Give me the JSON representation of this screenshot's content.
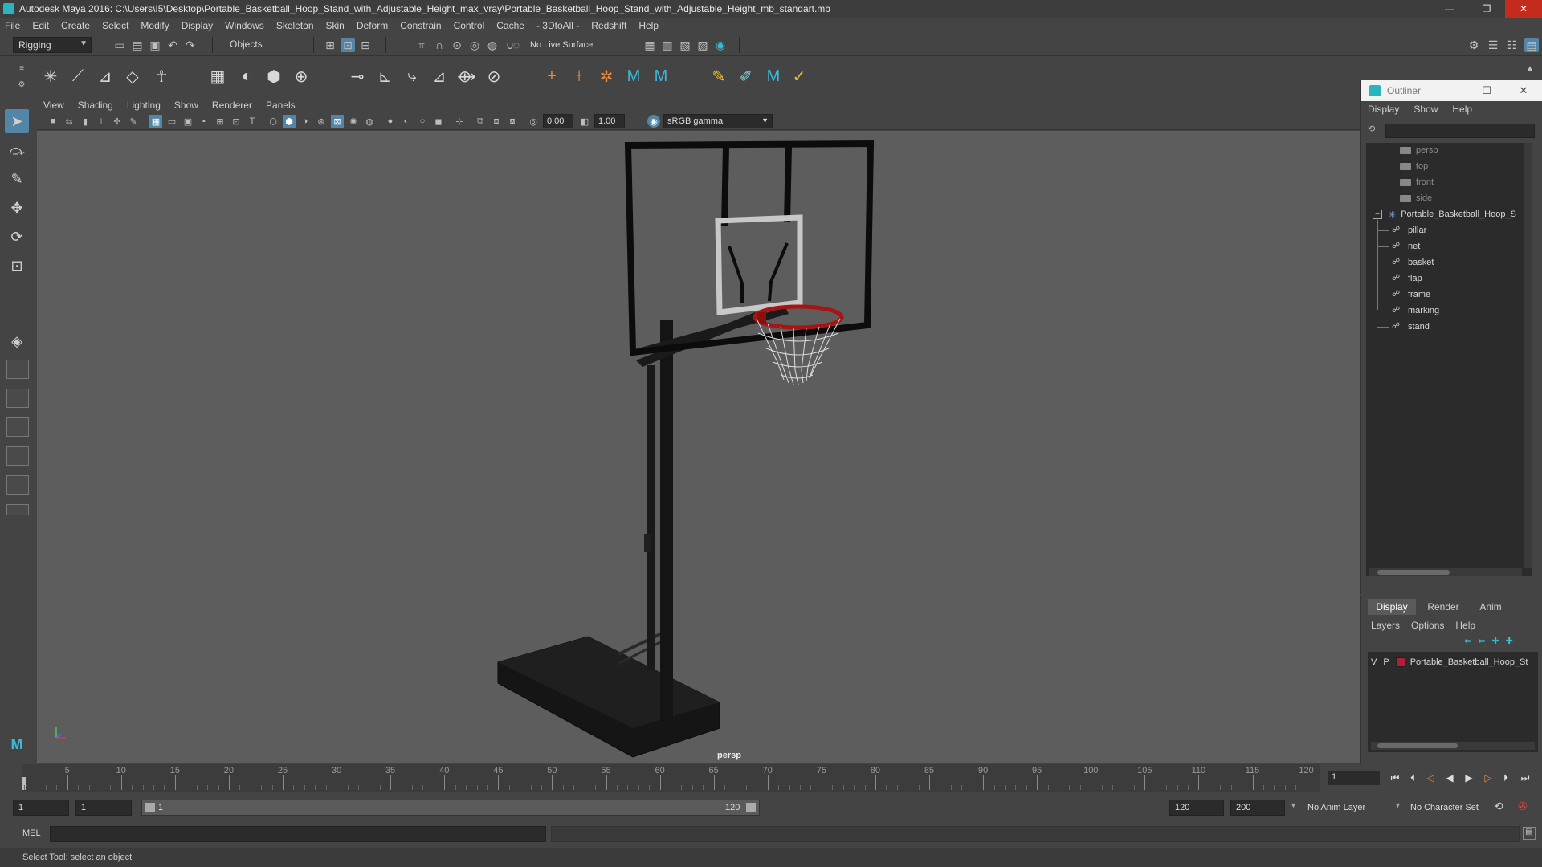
{
  "window": {
    "title": "Autodesk Maya 2016: C:\\Users\\I5\\Desktop\\Portable_Basketball_Hoop_Stand_with_Adjustable_Height_max_vray\\Portable_Basketball_Hoop_Stand_with_Adjustable_Height_mb_standart.mb",
    "minimize": "—",
    "maximize": "❐",
    "close": "✕"
  },
  "menubar": [
    "File",
    "Edit",
    "Create",
    "Select",
    "Modify",
    "Display",
    "Windows",
    "Skeleton",
    "Skin",
    "Deform",
    "Constrain",
    "Control",
    "Cache",
    "- 3DtoAll -",
    "Redshift",
    "Help"
  ],
  "statusline": {
    "menuset": "Rigging",
    "selection_mode": "Objects",
    "live_surface": "No Live Surface"
  },
  "viewport": {
    "menu": [
      "View",
      "Shading",
      "Lighting",
      "Show",
      "Renderer",
      "Panels"
    ],
    "exposure": "0.00",
    "gamma": "1.00",
    "color_space": "sRGB gamma",
    "camera_label": "persp"
  },
  "outliner": {
    "title": "Outliner",
    "menu": [
      "Display",
      "Show",
      "Help"
    ],
    "cameras": [
      "persp",
      "top",
      "front",
      "side"
    ],
    "group": "Portable_Basketball_Hoop_S",
    "children": [
      "pillar",
      "net",
      "basket",
      "flap",
      "frame",
      "marking",
      "stand"
    ]
  },
  "layers": {
    "tabs": [
      "Display",
      "Render",
      "Anim"
    ],
    "menu": [
      "Layers",
      "Options",
      "Help"
    ],
    "layer": {
      "v": "V",
      "p": "P",
      "name": "Portable_Basketball_Hoop_St",
      "color": "#b01f3a"
    }
  },
  "timeline": {
    "ticks": [
      "5",
      "10",
      "15",
      "20",
      "25",
      "30",
      "35",
      "40",
      "45",
      "50",
      "55",
      "60",
      "65",
      "70",
      "75",
      "80",
      "85",
      "90",
      "95",
      "100",
      "105",
      "110",
      "115",
      "120"
    ],
    "start_marker": "1",
    "current_frame": "1"
  },
  "range": {
    "start": "1",
    "anim_start": "1",
    "range_start_label": "1",
    "range_end_label": "120",
    "range_end": "120",
    "anim_end": "200",
    "anim_layer": "No Anim Layer",
    "char_set": "No Character Set"
  },
  "cmdline": {
    "label": "MEL"
  },
  "helpline": {
    "text": "Select Tool: select an object"
  }
}
